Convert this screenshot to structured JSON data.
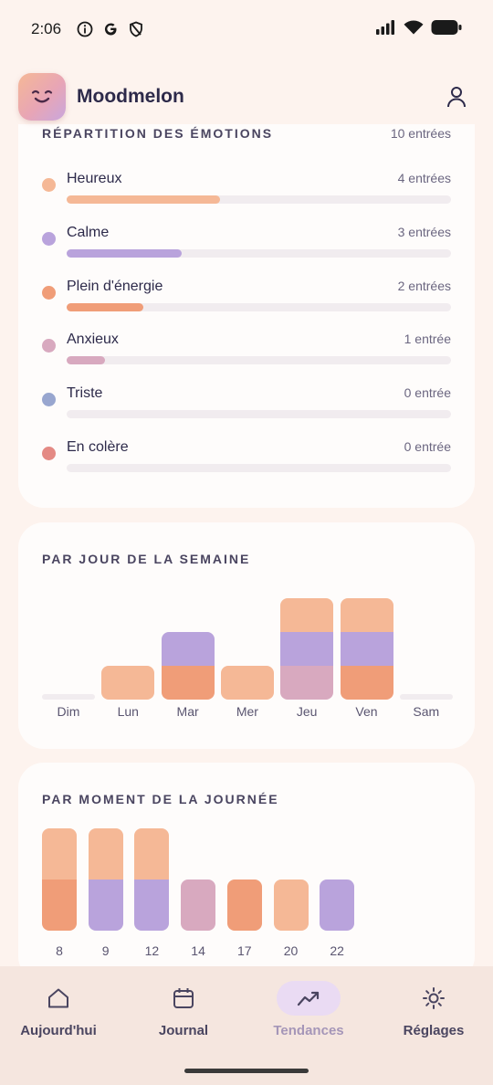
{
  "status_bar": {
    "time": "2:06",
    "icons": [
      "info-icon",
      "google-icon",
      "shield-icon"
    ],
    "right_icons": [
      "signal-icon",
      "wifi-icon",
      "battery-icon"
    ]
  },
  "header": {
    "app_name": "Moodmelon",
    "logo_icon": "smile-face-icon",
    "profile_icon": "user-icon"
  },
  "emotions": {
    "title": "RÉPARTITION DES ÉMOTIONS",
    "total": "10 entrées",
    "items": [
      {
        "label": "Heureux",
        "count": "4 entrées",
        "fraction": 0.4,
        "color": "#f5b896"
      },
      {
        "label": "Calme",
        "count": "3 entrées",
        "fraction": 0.3,
        "color": "#b9a3dc"
      },
      {
        "label": "Plein d'énergie",
        "count": "2 entrées",
        "fraction": 0.2,
        "color": "#f09d78"
      },
      {
        "label": "Anxieux",
        "count": "1 entrée",
        "fraction": 0.1,
        "color": "#d8a9bf"
      },
      {
        "label": "Triste",
        "count": "0 entrée",
        "fraction": 0.0,
        "color": "#98a6cf"
      },
      {
        "label": "En colère",
        "count": "0 entrée",
        "fraction": 0.0,
        "color": "#e48a84"
      }
    ]
  },
  "week": {
    "title": "PAR JOUR DE LA SEMAINE",
    "days": [
      {
        "label": "Dim",
        "segments": []
      },
      {
        "label": "Lun",
        "segments": [
          "Heureux"
        ]
      },
      {
        "label": "Mar",
        "segments": [
          "Plein d'énergie",
          "Calme"
        ]
      },
      {
        "label": "Mer",
        "segments": [
          "Heureux"
        ]
      },
      {
        "label": "Jeu",
        "segments": [
          "Anxieux",
          "Calme",
          "Heureux"
        ]
      },
      {
        "label": "Ven",
        "segments": [
          "Plein d'énergie",
          "Calme",
          "Heureux"
        ]
      },
      {
        "label": "Sam",
        "segments": []
      }
    ]
  },
  "time_of_day": {
    "title": "PAR MOMENT DE LA JOURNÉE",
    "hours": [
      {
        "label": "8",
        "segments": [
          "Plein d'énergie",
          "Heureux"
        ]
      },
      {
        "label": "9",
        "segments": [
          "Calme",
          "Heureux"
        ]
      },
      {
        "label": "12",
        "segments": [
          "Calme",
          "Heureux"
        ]
      },
      {
        "label": "14",
        "segments": [
          "Anxieux"
        ]
      },
      {
        "label": "17",
        "segments": [
          "Plein d'énergie"
        ]
      },
      {
        "label": "20",
        "segments": [
          "Heureux"
        ]
      },
      {
        "label": "22",
        "segments": [
          "Calme"
        ]
      }
    ]
  },
  "nav": {
    "items": [
      {
        "label": "Aujourd'hui",
        "icon": "home-icon"
      },
      {
        "label": "Journal",
        "icon": "calendar-icon"
      },
      {
        "label": "Tendances",
        "icon": "trend-icon",
        "active": true
      },
      {
        "label": "Réglages",
        "icon": "settings-icon"
      }
    ]
  }
}
